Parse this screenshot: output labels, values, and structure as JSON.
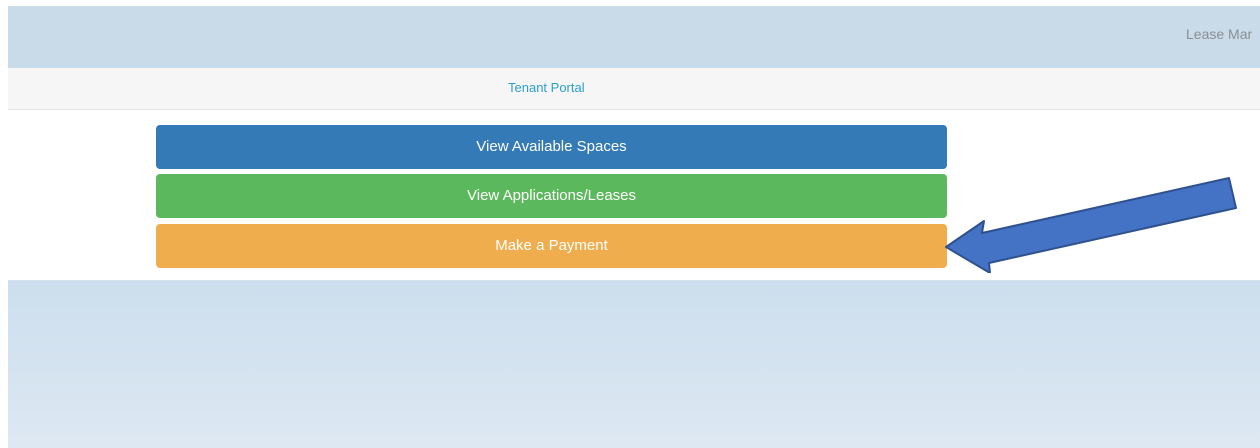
{
  "header": {
    "app_name": "Lease Mar"
  },
  "tabs": {
    "tenant_portal": "Tenant Portal"
  },
  "actions": {
    "view_spaces": "View Available Spaces",
    "view_applications": "View Applications/Leases",
    "make_payment": "Make a Payment"
  },
  "colors": {
    "header_bg": "#c9dbe9",
    "spaces_button": "#337ab7",
    "applications_button": "#5cb85c",
    "payment_button": "#f0ad4e",
    "annotation_arrow": "#4472c4"
  },
  "annotation": {
    "icon": "arrow-pointing-left-icon"
  }
}
